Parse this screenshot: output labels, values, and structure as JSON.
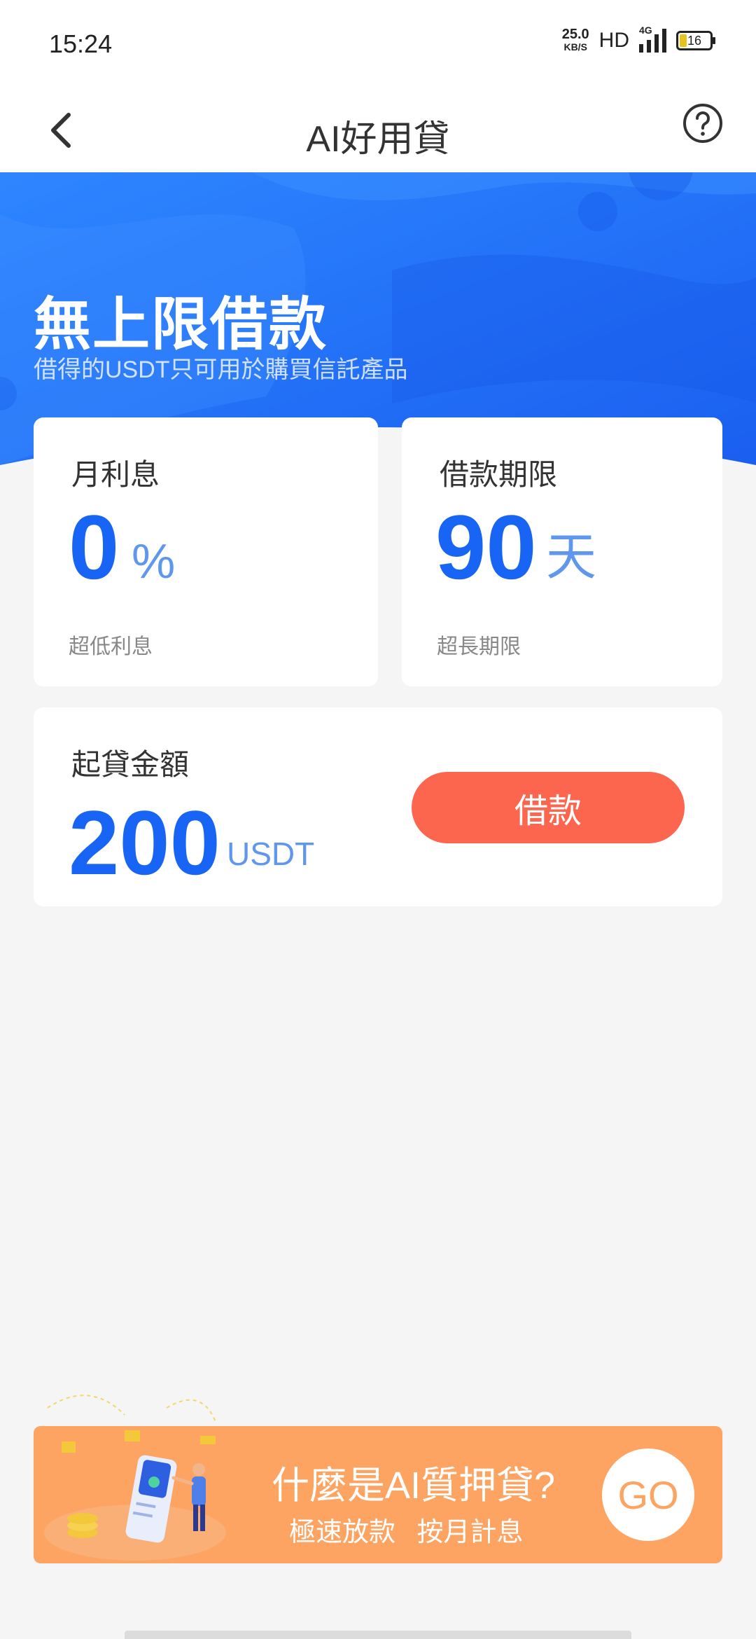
{
  "status_bar": {
    "time": "15:24",
    "net_speed": "25.0",
    "net_speed_unit": "KB/S",
    "hd": "HD",
    "network": "4G",
    "battery": "16"
  },
  "header": {
    "title": "AI好用貸",
    "back_icon": "chevron-left-icon",
    "help_icon": "question-circle-icon"
  },
  "hero": {
    "title": "無上限借款",
    "subtitle": "借得的USDT只可用於購買信託產品",
    "colors": {
      "start": "#2e86ff",
      "end": "#1a5ff0"
    }
  },
  "cards": {
    "interest": {
      "label": "月利息",
      "value": "0",
      "unit": "%",
      "note": "超低利息"
    },
    "term": {
      "label": "借款期限",
      "value": "90",
      "unit": "天",
      "note": "超長期限"
    },
    "min_amount": {
      "label": "起貸金額",
      "value": "200",
      "unit": "USDT",
      "button_label": "借款"
    }
  },
  "banner": {
    "title": "什麼是AI質押貸?",
    "subtitle": "極速放款 按月計息",
    "go_label": "GO"
  },
  "colors": {
    "accent_blue": "#1864f5",
    "unit_blue": "#5f97ef",
    "loan_button": "#fd664e",
    "banner": "#fda462"
  }
}
